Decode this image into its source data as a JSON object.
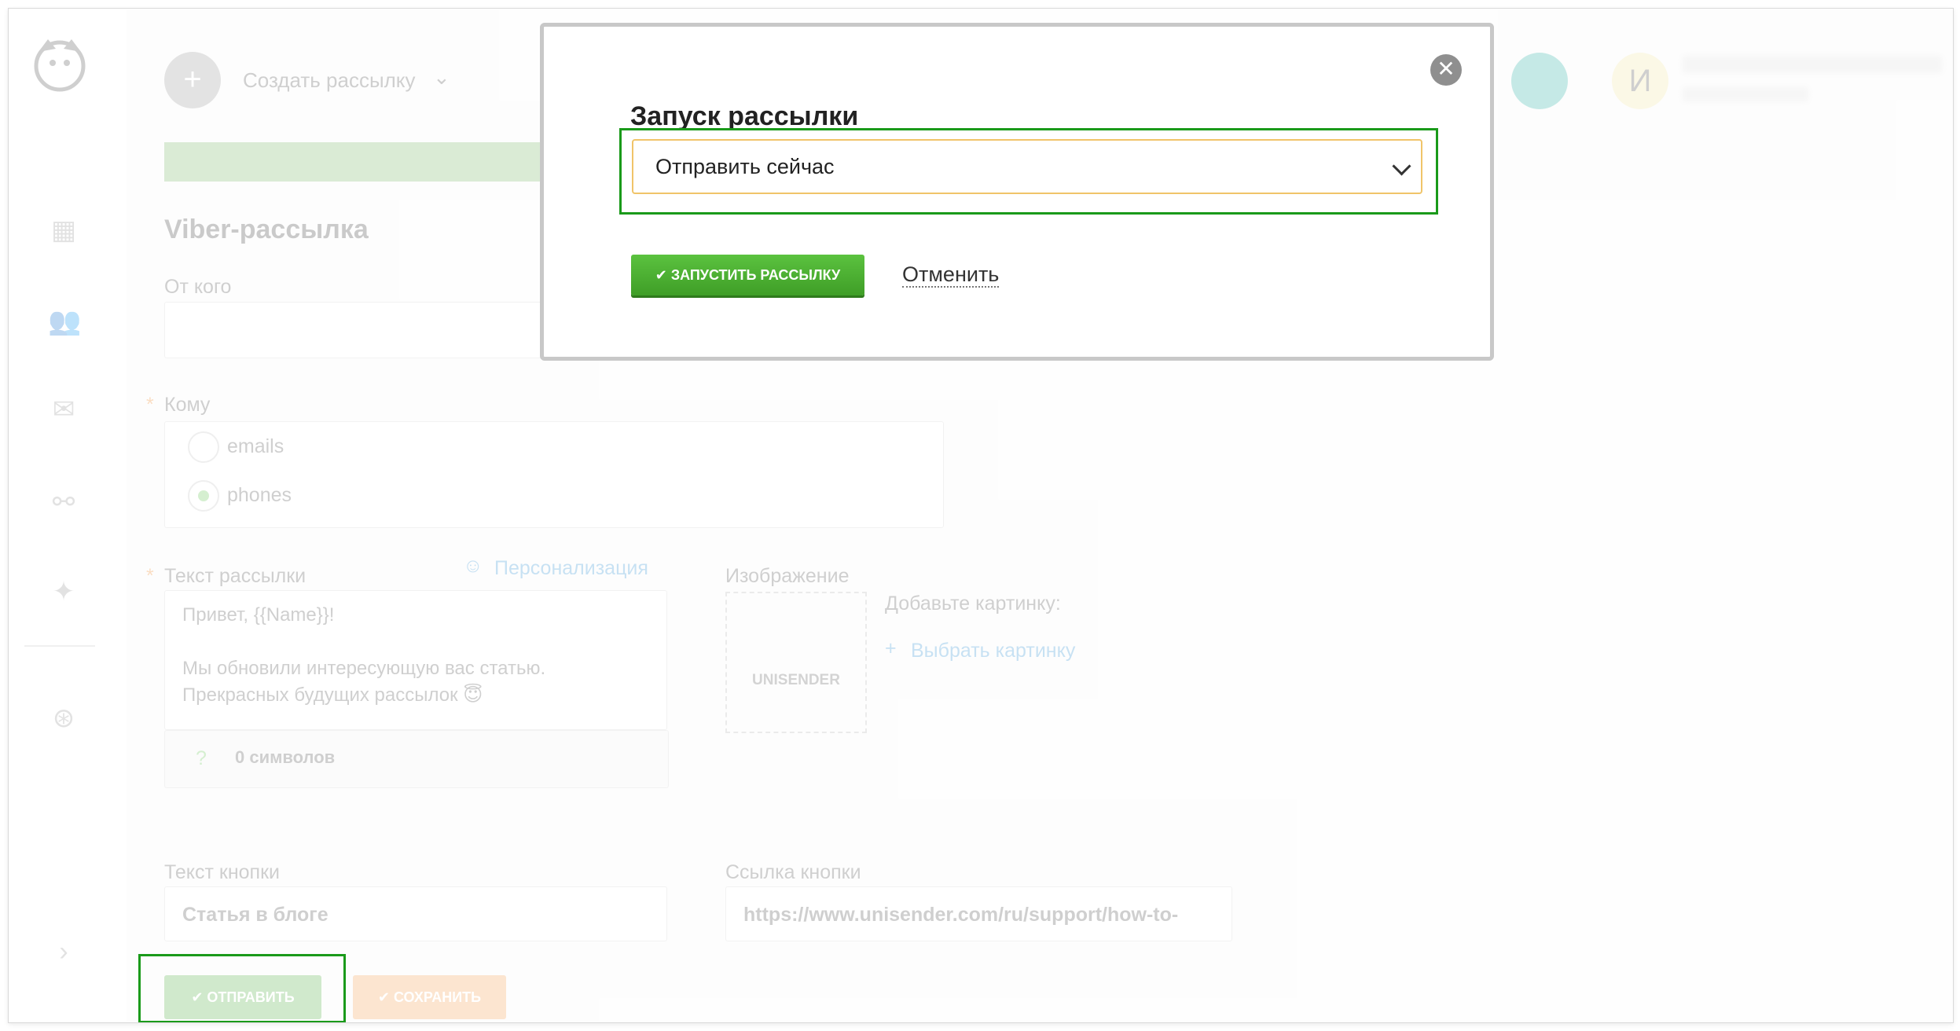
{
  "header": {
    "create_label": "Создать рассылку",
    "avatar_letter": "И"
  },
  "form": {
    "title": "Viber-рассылка",
    "from_label": "От кого",
    "to_label": "Кому",
    "required_mark": "*",
    "recipients": [
      {
        "label": "emails",
        "selected": false
      },
      {
        "label": "phones",
        "selected": true
      }
    ],
    "message_label": "Текст рассылки",
    "personalization_label": "Персонализация",
    "message_lines": [
      "Привет, {{Name}}!",
      "",
      "Мы обновили интересующую вас статью.",
      "Прекрасных будущих рассылок 😇"
    ],
    "char_count": "0 символов",
    "image_label": "Изображение",
    "add_image_label": "Добавьте картинку:",
    "choose_image_label": "Выбрать картинку",
    "image_placeholder_brand": "UNISENDER",
    "button_text_label": "Текст кнопки",
    "button_text_value": "Статья в блоге",
    "button_link_label": "Ссылка кнопки",
    "button_link_value": "https://www.unisender.com/ru/support/how-to-",
    "send_button": "ОТПРАВИТЬ",
    "save_button": "СОХРАНИТЬ"
  },
  "modal": {
    "title": "Запуск рассылки",
    "select_value": "Отправить сейчас",
    "launch_button": "ЗАПУСТИТЬ РАССЫЛКУ",
    "cancel_link": "Отменить",
    "close_symbol": "✕"
  },
  "colors": {
    "accent_green": "#4cae32",
    "highlight_green": "#1a9a1a",
    "select_border": "#f0c469"
  }
}
